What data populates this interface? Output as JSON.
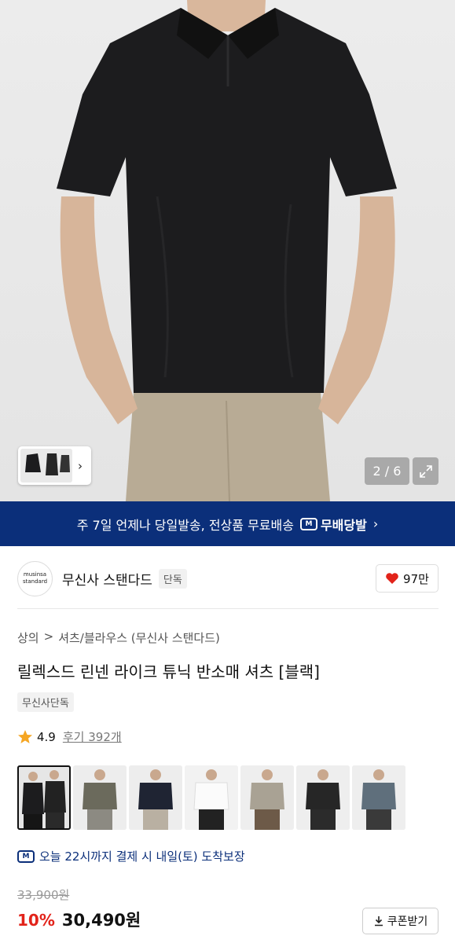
{
  "gallery": {
    "counter": "2 / 6",
    "thumb_strip_icon": "chevron-right-icon",
    "expand_icon": "expand-icon"
  },
  "banner": {
    "text": "주 7일 언제나 당일발송, 전상품 무료배송",
    "badge_logo": "M",
    "badge_label": "무배당발",
    "arrow": "›"
  },
  "brand": {
    "logo_line1": "musinsa",
    "logo_line2": "standard",
    "name": "무신사 스탠다드",
    "tag": "단독",
    "like_count": "97만",
    "like_icon": "heart-icon",
    "like_color": "#e2231a"
  },
  "breadcrumb": {
    "items": [
      "상의",
      "셔츠/블라우스 (무신사 스탠다드)"
    ],
    "separator": ">"
  },
  "product": {
    "title": "릴렉스드 린넨 라이크 튜닉 반소매 셔츠 [블랙]",
    "exclusive_tag": "무신사단독",
    "rating": "4.9",
    "reviews": "후기 392개",
    "rating_icon": "star-icon"
  },
  "color_options": [
    {
      "name": "black-pair",
      "selected": true
    },
    {
      "name": "khaki",
      "selected": false
    },
    {
      "name": "navy",
      "selected": false
    },
    {
      "name": "white",
      "selected": false
    },
    {
      "name": "beige",
      "selected": false
    },
    {
      "name": "black",
      "selected": false
    },
    {
      "name": "blue-grey",
      "selected": false
    }
  ],
  "delivery": {
    "logo": "M",
    "text": "오늘 22시까지 결제 시 내일(토) 도착보장"
  },
  "price": {
    "original": "33,900원",
    "discount": "10%",
    "final": "30,490원",
    "coupon_label": "쿠폰받기",
    "coupon_icon": "download-icon"
  },
  "colors": {
    "banner_bg": "#0b2f7a",
    "discount": "#e2231a",
    "star": "#f5a623"
  }
}
